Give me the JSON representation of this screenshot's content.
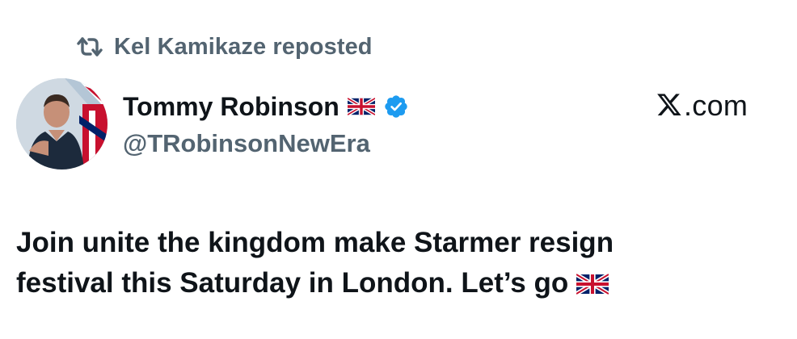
{
  "repost": {
    "icon": "repost-icon",
    "text": "Kel Kamikaze reposted"
  },
  "author": {
    "avatar": "avatar",
    "name": "Tommy Robinson",
    "name_badge": "uk-flag-icon",
    "verified": "verified-badge-icon",
    "handle": "@TRobinsonNewEra"
  },
  "watermark": {
    "text": ".com",
    "logo": "x-logo-icon"
  },
  "post": {
    "lines": [
      "Join unite the kingdom make Starmer resign",
      "festival this Saturday in London. Let’s go"
    ],
    "trailing_emoji": "uk-flag-icon"
  },
  "colors": {
    "text_primary": "#0f1419",
    "text_secondary": "#536471",
    "verified_blue": "#1d9bf0"
  }
}
